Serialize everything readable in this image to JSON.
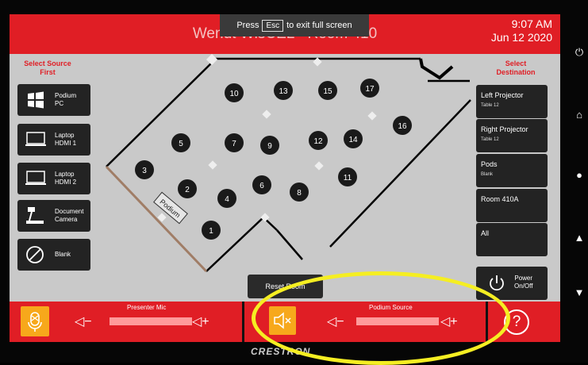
{
  "header": {
    "title": "Wendt WisCEL - Room 410",
    "time": "9:07 AM",
    "date": "Jun 12 2020",
    "fullscreen_prefix": "Press",
    "fullscreen_key": "Esc",
    "fullscreen_suffix": "to exit full screen"
  },
  "sources": {
    "heading_line1": "Select Source",
    "heading_line2": "First",
    "items": [
      {
        "line1": "Podium",
        "line2": "PC",
        "icon": "windows-icon"
      },
      {
        "line1": "Laptop",
        "line2": "HDMI 1",
        "icon": "laptop-icon"
      },
      {
        "line1": "Laptop",
        "line2": "HDMI 2",
        "icon": "laptop-icon"
      },
      {
        "line1": "Document",
        "line2": "Camera",
        "icon": "document-camera-icon"
      },
      {
        "line1": "Blank",
        "line2": "",
        "icon": "blank-icon"
      }
    ]
  },
  "destinations": {
    "heading_line1": "Select",
    "heading_line2": "Destination",
    "items": [
      {
        "line1": "Left Projector",
        "line2": "Table 12"
      },
      {
        "line1": "Right Projector",
        "line2": "Table 12"
      },
      {
        "line1": "Pods",
        "line2": "Blank"
      },
      {
        "line1": "Room 410A",
        "line2": ""
      },
      {
        "line1": "All",
        "line2": ""
      }
    ],
    "power_line1": "Power",
    "power_line2": "On/Off"
  },
  "room": {
    "podium_label": "Podium",
    "tables": [
      "1",
      "2",
      "3",
      "4",
      "5",
      "6",
      "7",
      "8",
      "9",
      "10",
      "11",
      "12",
      "13",
      "14",
      "15",
      "16",
      "17"
    ]
  },
  "reset_label": "Reset Room",
  "audio": {
    "presenter_mic_label": "Presenter Mic",
    "podium_source_label": "Podium Source",
    "volume_down": "◁−",
    "volume_up": "◁+"
  },
  "help_label": "?",
  "brand": "CRESTRON",
  "colors": {
    "accent": "#e01e25",
    "button": "#232323",
    "highlight": "#f7a81b",
    "annotation": "#f5ee22"
  }
}
